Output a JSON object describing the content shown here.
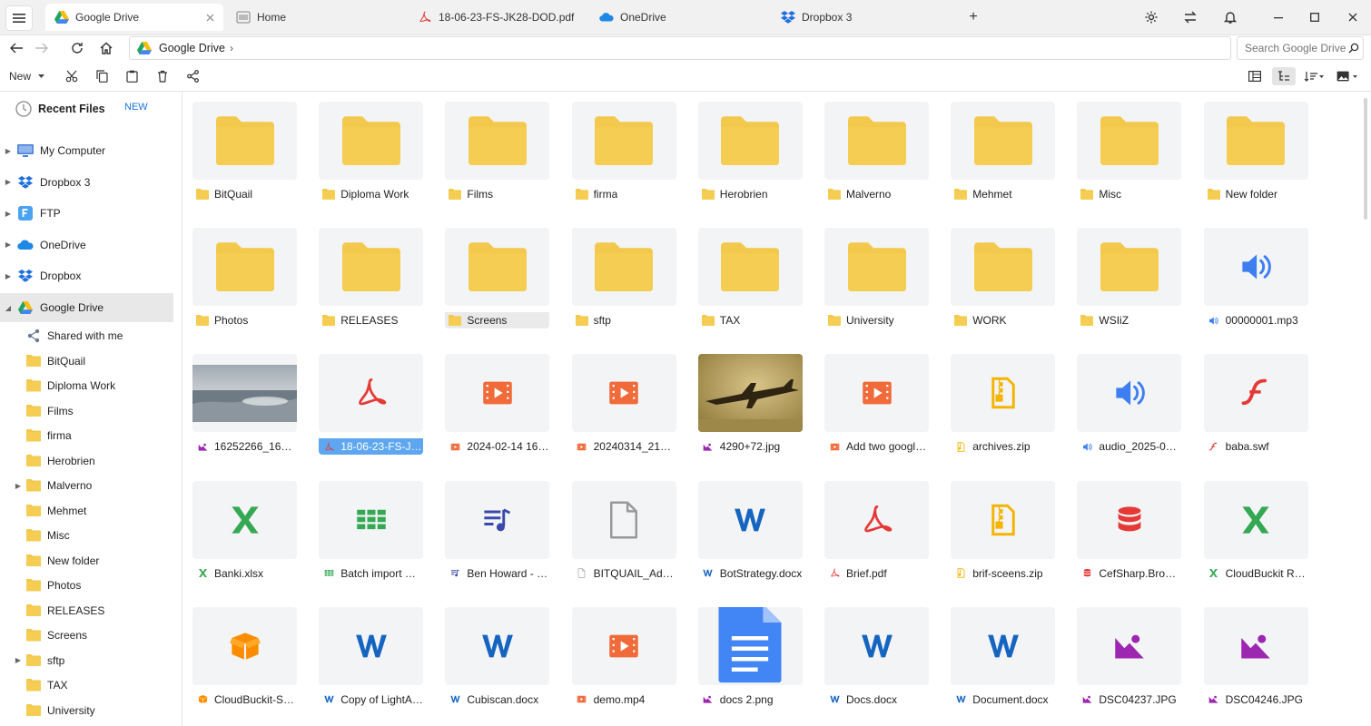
{
  "tabs": [
    {
      "label": "Google Drive",
      "icon": "google-drive-icon",
      "active": true
    },
    {
      "label": "Home",
      "icon": "home-tab-icon"
    },
    {
      "label": "18-06-23-FS-JK28-DOD.pdf",
      "icon": "pdf-icon"
    },
    {
      "label": "OneDrive",
      "icon": "onedrive-icon"
    },
    {
      "label": "Dropbox 3",
      "icon": "dropbox-icon"
    }
  ],
  "address": {
    "path": "Google Drive",
    "separator": "›"
  },
  "search": {
    "placeholder": "Search Google Drive"
  },
  "toolbar": {
    "new_label": "New"
  },
  "sidebar": {
    "recent_label": "Recent Files",
    "new_label": "NEW",
    "roots": [
      {
        "label": "My Computer",
        "icon": "computer-icon"
      },
      {
        "label": "Dropbox 3",
        "icon": "dropbox-icon"
      },
      {
        "label": "FTP",
        "icon": "ftp-icon"
      },
      {
        "label": "OneDrive",
        "icon": "onedrive-icon"
      },
      {
        "label": "Dropbox",
        "icon": "dropbox-icon"
      },
      {
        "label": "Google Drive",
        "icon": "google-drive-icon",
        "selected": true
      }
    ],
    "children": [
      {
        "label": "Shared with me",
        "icon": "share-icon"
      },
      {
        "label": "BitQuail",
        "icon": "folder-icon"
      },
      {
        "label": "Diploma Work",
        "icon": "folder-icon"
      },
      {
        "label": "Films",
        "icon": "folder-icon"
      },
      {
        "label": "firma",
        "icon": "folder-icon"
      },
      {
        "label": "Herobrien",
        "icon": "folder-icon"
      },
      {
        "label": "Malverno",
        "icon": "folder-icon",
        "expandable": true
      },
      {
        "label": "Mehmet",
        "icon": "folder-icon"
      },
      {
        "label": "Misc",
        "icon": "folder-icon"
      },
      {
        "label": "New folder",
        "icon": "folder-icon"
      },
      {
        "label": "Photos",
        "icon": "folder-icon"
      },
      {
        "label": "RELEASES",
        "icon": "folder-icon"
      },
      {
        "label": "Screens",
        "icon": "folder-icon"
      },
      {
        "label": "sftp",
        "icon": "folder-icon",
        "expandable": true
      },
      {
        "label": "TAX",
        "icon": "folder-icon"
      },
      {
        "label": "University",
        "icon": "folder-icon"
      }
    ]
  },
  "files": [
    {
      "name": "BitQuail",
      "type": "folder"
    },
    {
      "name": "Diploma Work",
      "type": "folder"
    },
    {
      "name": "Films",
      "type": "folder"
    },
    {
      "name": "firma",
      "type": "folder"
    },
    {
      "name": "Herobrien",
      "type": "folder"
    },
    {
      "name": "Malverno",
      "type": "folder"
    },
    {
      "name": "Mehmet",
      "type": "folder"
    },
    {
      "name": "Misc",
      "type": "folder"
    },
    {
      "name": "New folder",
      "type": "folder"
    },
    {
      "name": "Photos",
      "type": "folder"
    },
    {
      "name": "RELEASES",
      "type": "folder"
    },
    {
      "name": "Screens",
      "type": "folder",
      "hover": true
    },
    {
      "name": "sftp",
      "type": "folder"
    },
    {
      "name": "TAX",
      "type": "folder"
    },
    {
      "name": "University",
      "type": "folder"
    },
    {
      "name": "WORK",
      "type": "folder"
    },
    {
      "name": "WSIiZ",
      "type": "folder"
    },
    {
      "name": "00000001.mp3",
      "type": "audio"
    },
    {
      "name": "16252266_1619...",
      "type": "photo-sea"
    },
    {
      "name": "18-06-23-FS-JK...",
      "type": "pdf",
      "selected": true
    },
    {
      "name": "2024-02-14 16-...",
      "type": "video"
    },
    {
      "name": "20240314_2157...",
      "type": "video"
    },
    {
      "name": "4290+72.jpg",
      "type": "photo-plane"
    },
    {
      "name": "Add two google...",
      "type": "video"
    },
    {
      "name": "archives.zip",
      "type": "zip"
    },
    {
      "name": "audio_2025-01-...",
      "type": "audio"
    },
    {
      "name": "baba.swf",
      "type": "flash"
    },
    {
      "name": "Banki.xlsx",
      "type": "excel"
    },
    {
      "name": "Batch import wi...",
      "type": "sheet"
    },
    {
      "name": "Ben Howard - E...",
      "type": "playlist"
    },
    {
      "name": "BITQUAIL_Admi...",
      "type": "file"
    },
    {
      "name": "BotStrategy.docx",
      "type": "word"
    },
    {
      "name": "Brief.pdf",
      "type": "pdf"
    },
    {
      "name": "brif-sceens.zip",
      "type": "zip"
    },
    {
      "name": "CefSharp.Brows...",
      "type": "database"
    },
    {
      "name": "CloudBuckit Ro...",
      "type": "excel"
    },
    {
      "name": "CloudBuckit-Set...",
      "type": "package"
    },
    {
      "name": "Copy of LightAc...",
      "type": "word"
    },
    {
      "name": "Cubiscan.docx",
      "type": "word"
    },
    {
      "name": "demo.mp4",
      "type": "video"
    },
    {
      "name": "docs 2.png",
      "type": "gdoc"
    },
    {
      "name": "Docs.docx",
      "type": "word"
    },
    {
      "name": "Document.docx",
      "type": "word"
    },
    {
      "name": "DSC04237.JPG",
      "type": "image"
    },
    {
      "name": "DSC04246.JPG",
      "type": "image"
    }
  ],
  "colors": {
    "folder": "#f2c94c",
    "accent": "#1a73e8",
    "audio": "#3d7ff0",
    "pdf": "#e53935",
    "video": "#f06a3a",
    "zip": "#f4b400",
    "excel": "#34a853",
    "word": "#1565c0",
    "image": "#9c27b0",
    "selected": "#5ea7f0"
  }
}
